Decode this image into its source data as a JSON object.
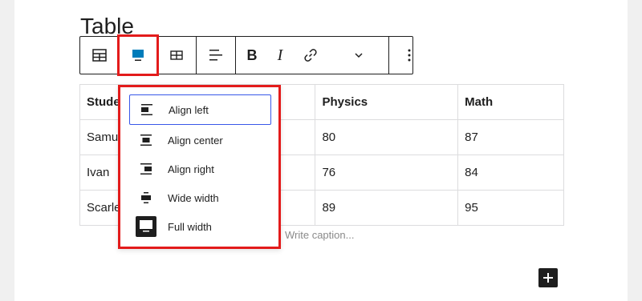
{
  "block": {
    "title": "Table"
  },
  "toolbar": {
    "buttons": [
      {
        "name": "table-icon",
        "label": "Table"
      },
      {
        "name": "align-full-icon",
        "label": "Align",
        "highlighted": true
      },
      {
        "name": "edit-table-icon",
        "label": "Edit table"
      },
      {
        "name": "align-left-icon",
        "label": "Align column"
      },
      {
        "name": "bold-icon",
        "text": "B"
      },
      {
        "name": "italic-icon",
        "text": "I"
      },
      {
        "name": "link-icon",
        "label": "Link"
      },
      {
        "name": "chevron-down-icon",
        "label": "More"
      },
      {
        "name": "more-options-icon",
        "label": "Options"
      }
    ]
  },
  "table": {
    "headers": [
      "Stude",
      "",
      "Physics",
      "Math"
    ],
    "rows": [
      [
        "Samu",
        "",
        "80",
        "87"
      ],
      [
        "Ivan",
        "",
        "76",
        "84"
      ],
      [
        "Scarle",
        "",
        "89",
        "95"
      ]
    ],
    "caption_placeholder": "Write caption..."
  },
  "align_menu": {
    "items": [
      {
        "label": "Align left",
        "icon": "align-left-icon",
        "active": true
      },
      {
        "label": "Align center",
        "icon": "align-center-icon",
        "active": false
      },
      {
        "label": "Align right",
        "icon": "align-right-icon",
        "active": false
      },
      {
        "label": "Wide width",
        "icon": "wide-width-icon",
        "active": false
      },
      {
        "label": "Full width",
        "icon": "full-width-icon",
        "active": false
      }
    ]
  },
  "colors": {
    "accent": "#007cba",
    "highlight": "#e31b1b",
    "focus": "#3858e9",
    "text": "#1e1e1e"
  }
}
